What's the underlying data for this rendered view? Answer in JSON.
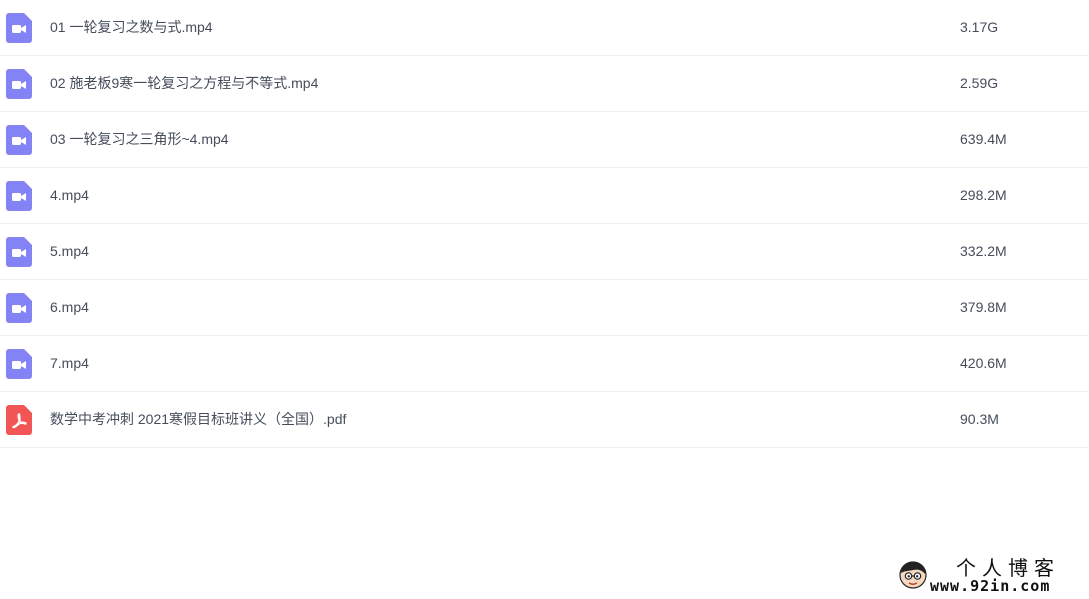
{
  "files": [
    {
      "name": "01 一轮复习之数与式.mp4",
      "size": "3.17G",
      "icon": "video-file-icon"
    },
    {
      "name": "02 施老板9寒一轮复习之方程与不等式.mp4",
      "size": "2.59G",
      "icon": "video-file-icon"
    },
    {
      "name": "03 一轮复习之三角形~4.mp4",
      "size": "639.4M",
      "icon": "video-file-icon"
    },
    {
      "name": "4.mp4",
      "size": "298.2M",
      "icon": "video-file-icon"
    },
    {
      "name": "5.mp4",
      "size": "332.2M",
      "icon": "video-file-icon"
    },
    {
      "name": "6.mp4",
      "size": "379.8M",
      "icon": "video-file-icon"
    },
    {
      "name": "7.mp4",
      "size": "420.6M",
      "icon": "video-file-icon"
    },
    {
      "name": "数学中考冲刺 2021寒假目标班讲义（全国）.pdf",
      "size": "90.3M",
      "icon": "pdf-file-icon"
    }
  ],
  "colors": {
    "video_icon": "#8383f6",
    "pdf_icon": "#f25555",
    "text": "#454d5a",
    "row_divider": "#f0f0f2"
  },
  "watermark": {
    "title": "个人博客",
    "url": "www.92in.com",
    "icon": "cartoon-avatar-icon"
  }
}
